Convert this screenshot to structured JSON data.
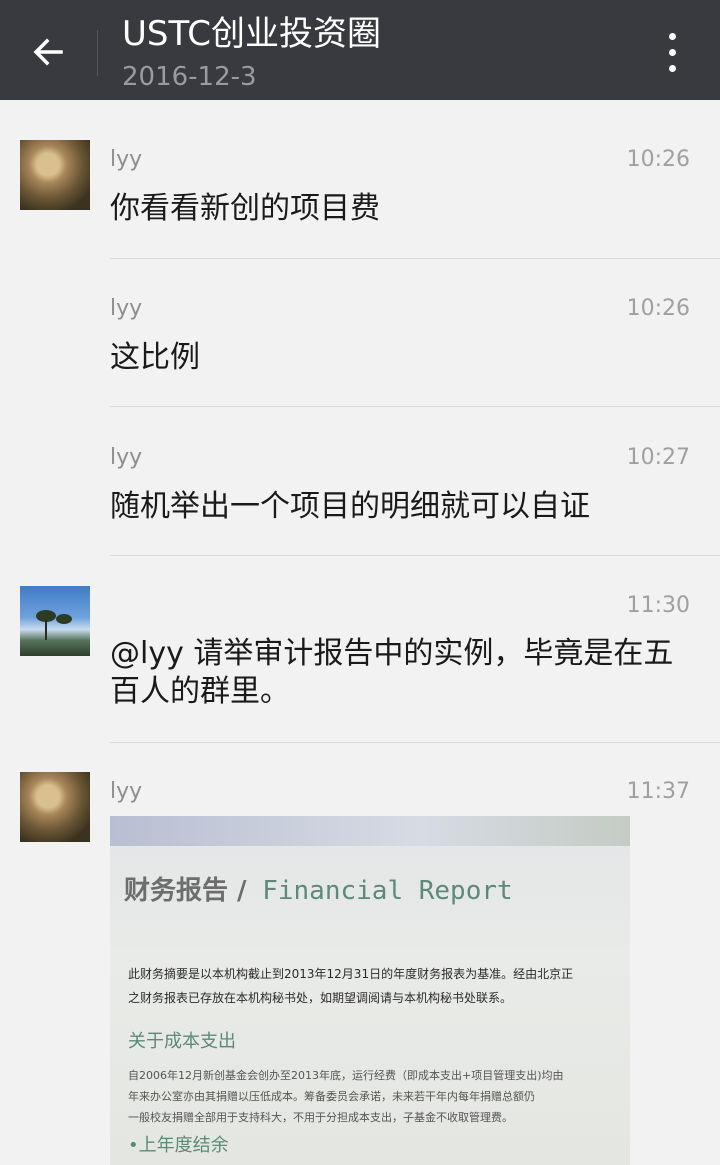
{
  "header": {
    "title": "USTC创业投资圈",
    "subtitle": "2016-12-3"
  },
  "messages": [
    {
      "sender": "lyy",
      "time": "10:26",
      "text": "你看看新创的项目费"
    },
    {
      "sender": "lyy",
      "time": "10:26",
      "text": "这比例"
    },
    {
      "sender": "lyy",
      "time": "10:27",
      "text": "随机举出一个项目的明细就可以自证"
    },
    {
      "sender": "",
      "time": "11:30",
      "text": "@lyy 请举审计报告中的实例，毕竟是在五百人的群里。"
    },
    {
      "sender": "lyy",
      "time": "11:37",
      "text": ""
    }
  ],
  "report_image": {
    "title_cn": "财务报告 /",
    "title_en": " Financial Report",
    "para1_line1": "此财务摘要是以本机构截止到2013年12月31日的年度财务报表为基准。经由北京正",
    "para1_line2": "之财务报表已存放在本机构秘书处，如期望调阅请与本机构秘书处联系。",
    "heading1": "关于成本支出",
    "para2_line1": "自2006年12月新创基金会创办至2013年底，运行经费（即成本支出+项目管理支出)均由",
    "para2_line2": "年来办公室亦由其捐赠以压低成本。筹备委员会承诺，未来若干年内每年捐赠总额仍",
    "para2_line3": "一般校友捐赠全部用于支持科大，不用于分担成本支出，子基金不收取管理费。",
    "heading2": "•上年度结余"
  },
  "icons": {
    "back": "arrow-left-icon",
    "more": "more-vertical-icon"
  },
  "colors": {
    "topbar": "#393a3f",
    "background": "#f2f2f2",
    "accent_green": "#5c8a78"
  }
}
